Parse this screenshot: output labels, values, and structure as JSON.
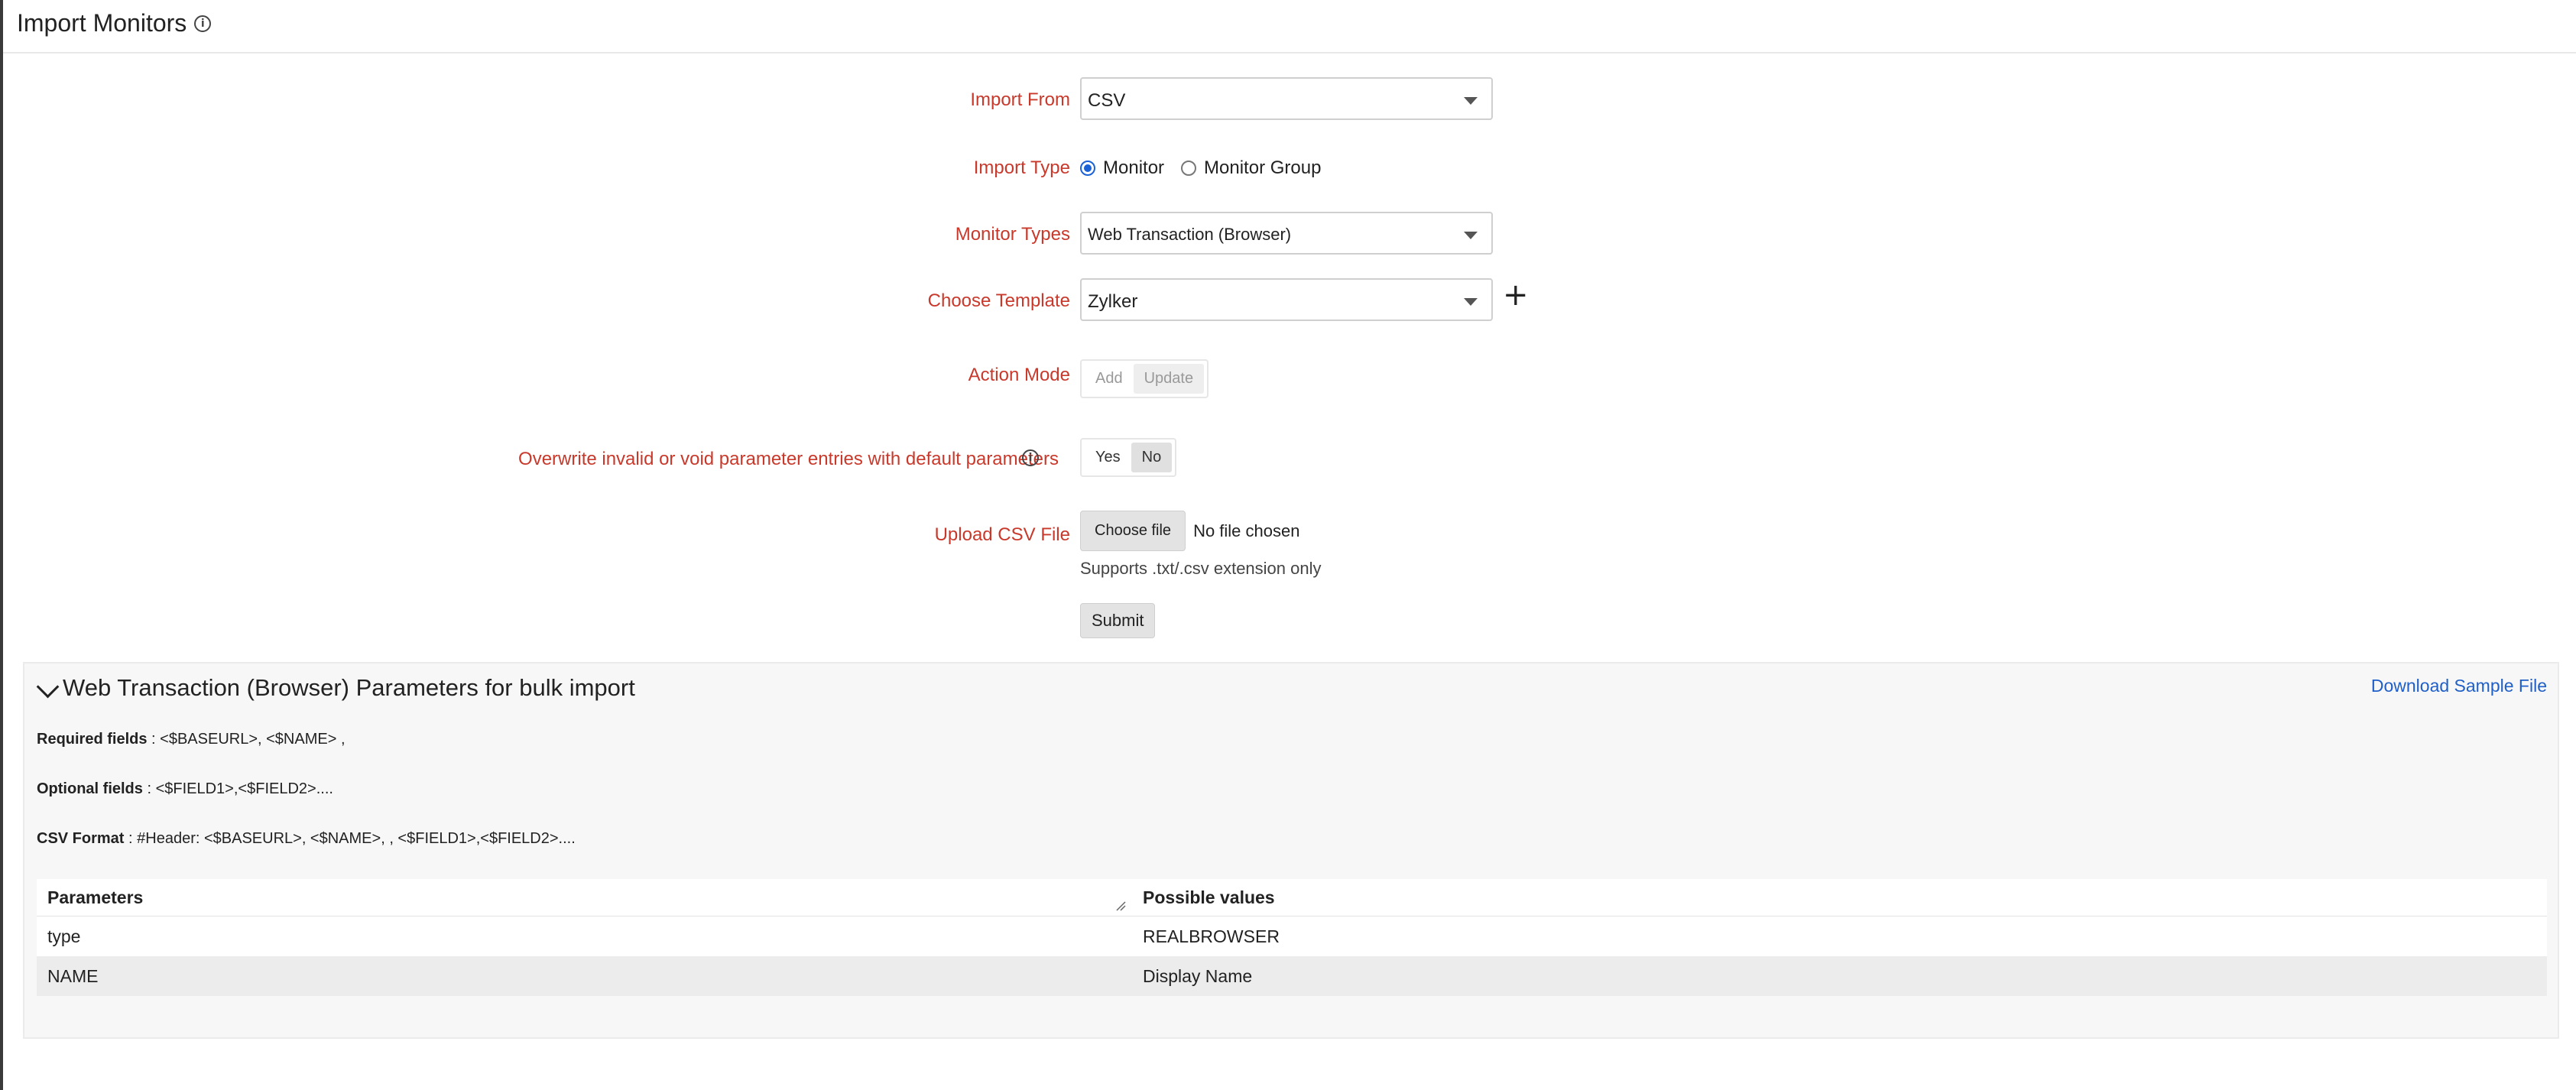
{
  "page": {
    "title": "Import Monitors",
    "title_info_icon": "info-icon"
  },
  "form": {
    "import_from": {
      "label": "Import From",
      "value": "CSV"
    },
    "import_type": {
      "label": "Import Type",
      "options": [
        "Monitor",
        "Monitor Group"
      ],
      "selected": "Monitor"
    },
    "monitor_types": {
      "label": "Monitor Types",
      "value": "Web Transaction (Browser)"
    },
    "choose_template": {
      "label": "Choose Template",
      "value": "Zylker",
      "add_icon": "plus-icon"
    },
    "action_mode": {
      "label": "Action Mode",
      "options": [
        "Add",
        "Update"
      ],
      "selected": "Update"
    },
    "overwrite": {
      "label": "Overwrite invalid or void parameter entries with default parameters",
      "options": [
        "Yes",
        "No"
      ],
      "selected": "No"
    },
    "upload": {
      "label": "Upload CSV File",
      "button": "Choose file",
      "status": "No file chosen",
      "hint": "Supports .txt/.csv extension only"
    },
    "submit": "Submit"
  },
  "params_panel": {
    "title": "Web Transaction (Browser) Parameters for bulk import",
    "download_link": "Download Sample File",
    "required": {
      "label": "Required fields",
      "value": " : <$BASEURL>, <$NAME> ,"
    },
    "optional": {
      "label": "Optional fields",
      "value": " : <$FIELD1>,<$FIELD2>...."
    },
    "csv_format": {
      "label": "CSV Format",
      "value": " : #Header: <$BASEURL>, <$NAME>, , <$FIELD1>,<$FIELD2>...."
    },
    "table": {
      "headers": [
        "Parameters",
        "Possible values"
      ],
      "rows": [
        [
          "type",
          "REALBROWSER"
        ],
        [
          "NAME",
          "Display Name"
        ]
      ]
    }
  },
  "colors": {
    "label_red": "#c8392b",
    "link_blue": "#1f5fc7",
    "radio_blue": "#1a62d6"
  }
}
